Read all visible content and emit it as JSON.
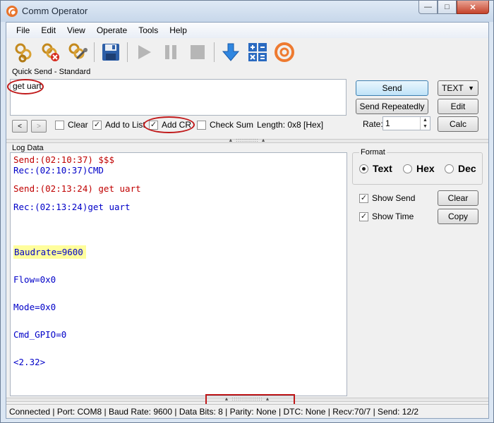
{
  "window": {
    "title": "Comm Operator"
  },
  "menu": [
    "File",
    "Edit",
    "View",
    "Operate",
    "Tools",
    "Help"
  ],
  "toolbar": [
    "connect-icon",
    "disconnect-icon",
    "port-settings-icon",
    "save-icon",
    "play-icon",
    "pause-icon",
    "stop-icon",
    "download-icon",
    "calculator-icon",
    "comm-operator-icon"
  ],
  "quick_send": {
    "label": "Quick Send - Standard",
    "text": "get uart",
    "send": "Send",
    "send_repeatedly": "Send Repeatedly",
    "mode": "TEXT",
    "edit": "Edit",
    "calc": "Calc",
    "rate_label": "Rate:",
    "rate_value": "1",
    "prev": "<",
    "next": ">",
    "clear": "Clear",
    "add_to_list": "Add to List",
    "add_cr": "Add CR",
    "check_sum": "Check Sum",
    "length": "Length: 0x8 [Hex]"
  },
  "log": {
    "label": "Log Data",
    "colors": {
      "send": "#c00000",
      "rec": "#0000c8",
      "highlight": "#fffe9c"
    },
    "lines": [
      "Send:(02:10:37) $$$",
      "Rec:(02:10:37)CMD",
      "Send:(02:13:24) get uart",
      "Rec:(02:13:24)get uart",
      "Baudrate=9600",
      "Flow=0x0",
      "Mode=0x0",
      "Cmd_GPIO=0",
      "<2.32>"
    ]
  },
  "format": {
    "label": "Format",
    "options": [
      "Text",
      "Hex",
      "Dec"
    ],
    "selected": "Text"
  },
  "options": {
    "show_send": "Show Send",
    "show_time": "Show Time",
    "clear": "Clear",
    "copy": "Copy"
  },
  "status": "Connected | Port: COM8 | Baud Rate: 9600 | Data Bits: 8 | Parity: None | DTC: None | Recv:70/7 | Send: 12/2"
}
